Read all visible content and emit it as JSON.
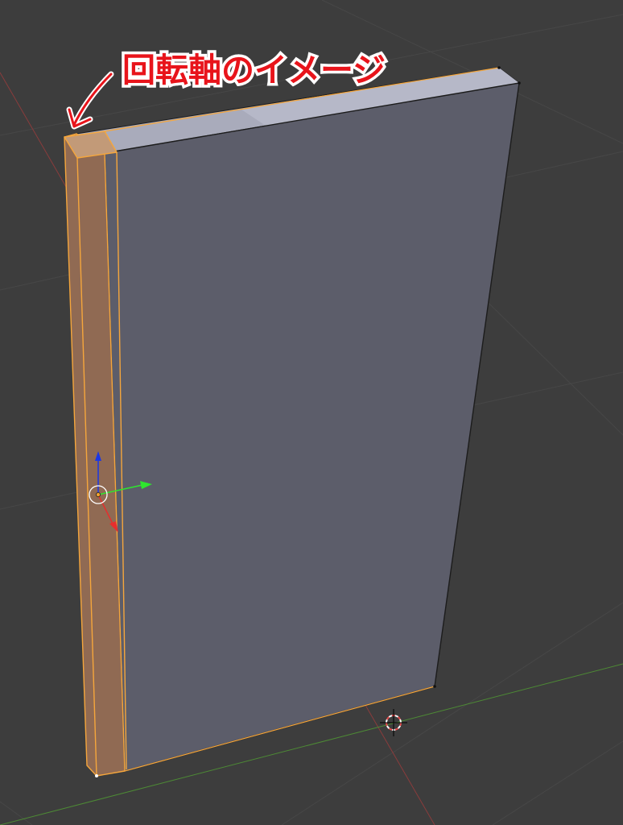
{
  "annotation": {
    "text": "回転軸のイメージ",
    "color": "#e8141b",
    "outline_color": "#ffffff"
  },
  "viewport": {
    "background_color": "#3d3d3d",
    "grid_color": "#474747",
    "x_axis_color": "#8a3c3c",
    "y_axis_color": "#4d8a35"
  },
  "door_mesh": {
    "face_color": "#5c5d6a",
    "top_face_color": "#a9abbb",
    "top_face_light_color": "#b6b8c8",
    "edge_color": "#1c1c1c",
    "selected_face_color": "#906a53",
    "selected_top_color": "#c29a78",
    "selection_edge_color": "#f5a63c"
  },
  "gizmo": {
    "z_axis_color": "#1a36e6",
    "y_axis_color": "#2ee62e",
    "x_axis_color": "#e62e2e"
  },
  "cursor_3d": {
    "ring_color_a": "#e64c4c",
    "ring_color_b": "#ffffff",
    "crosshair_color": "#000000"
  },
  "icons": {
    "pivot": "pivot-circle-icon",
    "cursor": "3d-cursor-icon",
    "arrow": "annotation-arrow-icon"
  }
}
